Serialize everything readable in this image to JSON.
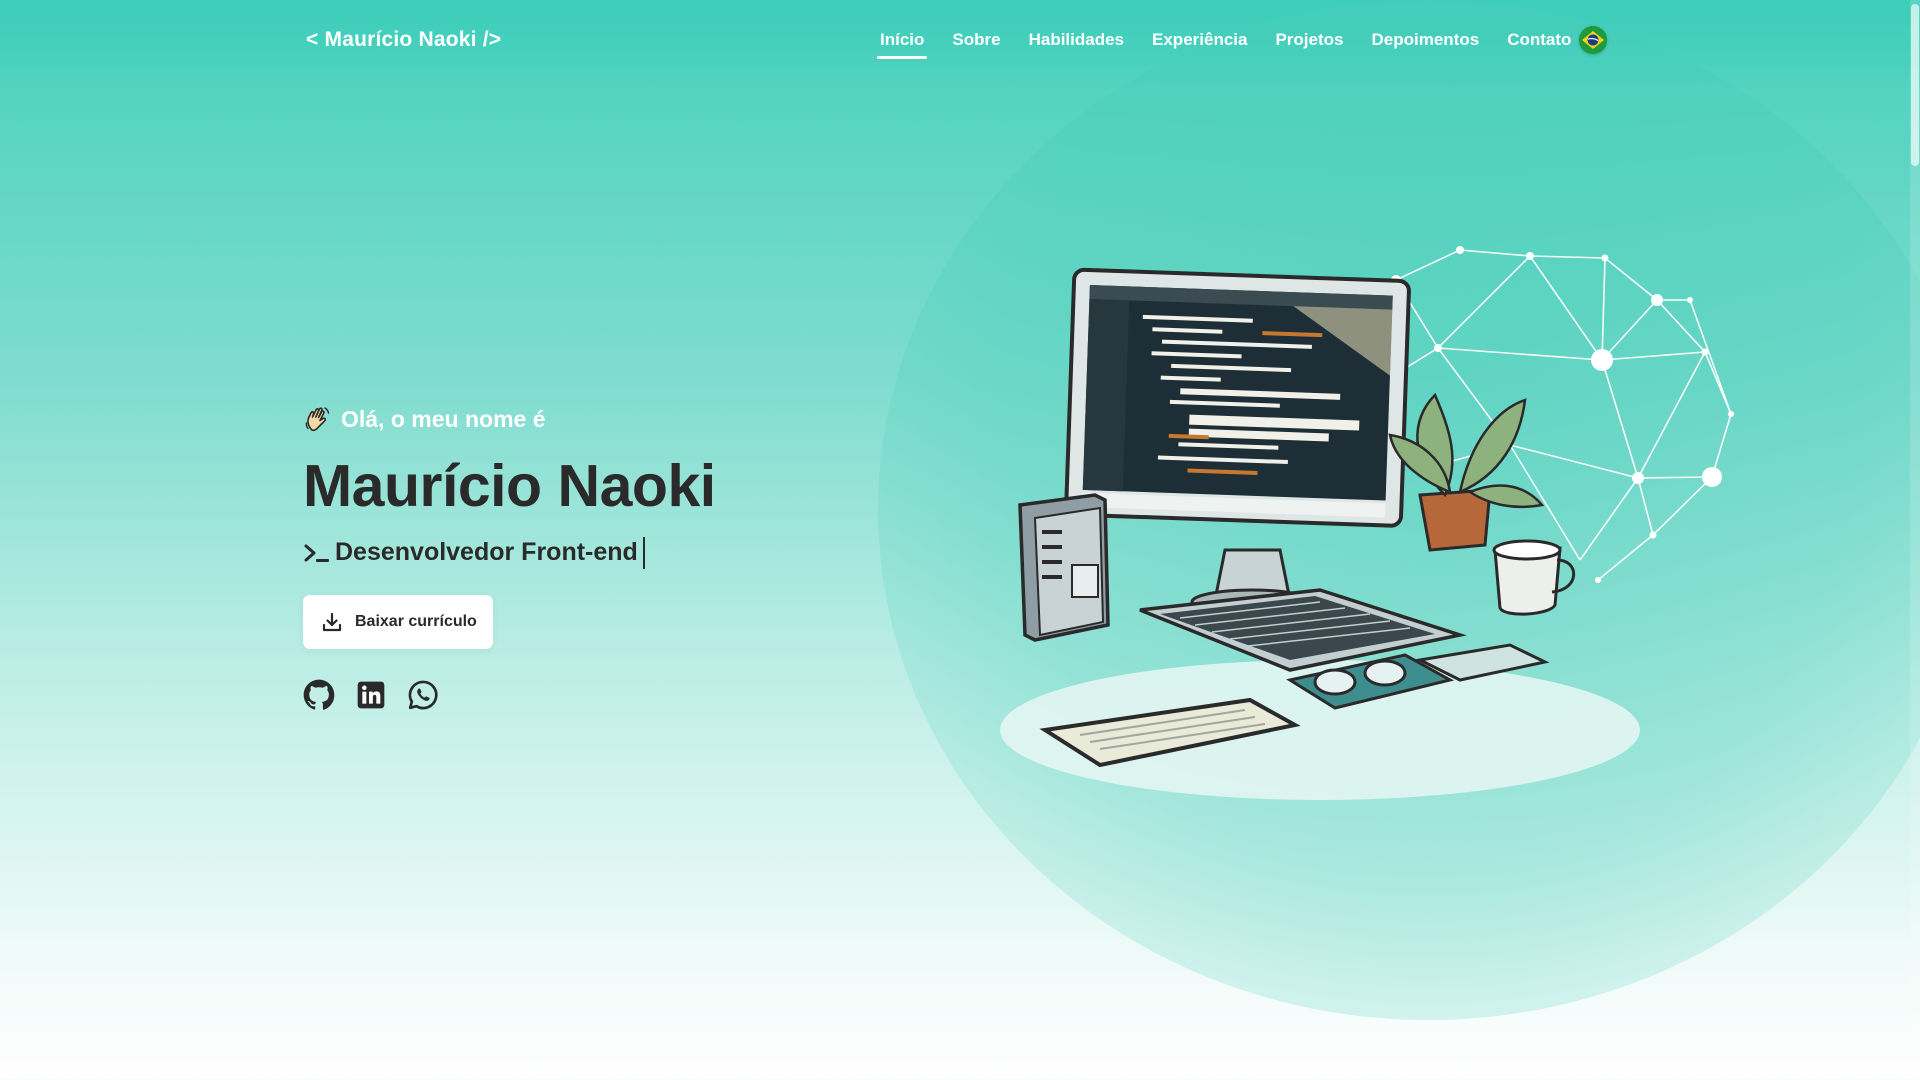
{
  "brand": {
    "label": "< Maurício Naoki />"
  },
  "nav": {
    "items": [
      {
        "label": "Início",
        "active": true
      },
      {
        "label": "Sobre"
      },
      {
        "label": "Habilidades"
      },
      {
        "label": "Experiência"
      },
      {
        "label": "Projetos"
      },
      {
        "label": "Depoimentos"
      },
      {
        "label": "Contato"
      }
    ],
    "language_icon": "brazil-flag-icon"
  },
  "hero": {
    "greeting": "Olá, o meu nome é",
    "greeting_icon": "waving-hand-icon",
    "name": "Maurício Naoki",
    "role": "Desenvolvedor Front-end",
    "role_icon": "terminal-prompt-icon",
    "cv_button": {
      "label": "Baixar currículo",
      "icon": "download-icon"
    },
    "socials": [
      {
        "icon": "github-icon"
      },
      {
        "icon": "linkedin-icon"
      },
      {
        "icon": "whatsapp-icon"
      }
    ]
  },
  "colors": {
    "primary": "#46d1bd",
    "text_dark": "#2a2a2a",
    "white": "#ffffff"
  }
}
